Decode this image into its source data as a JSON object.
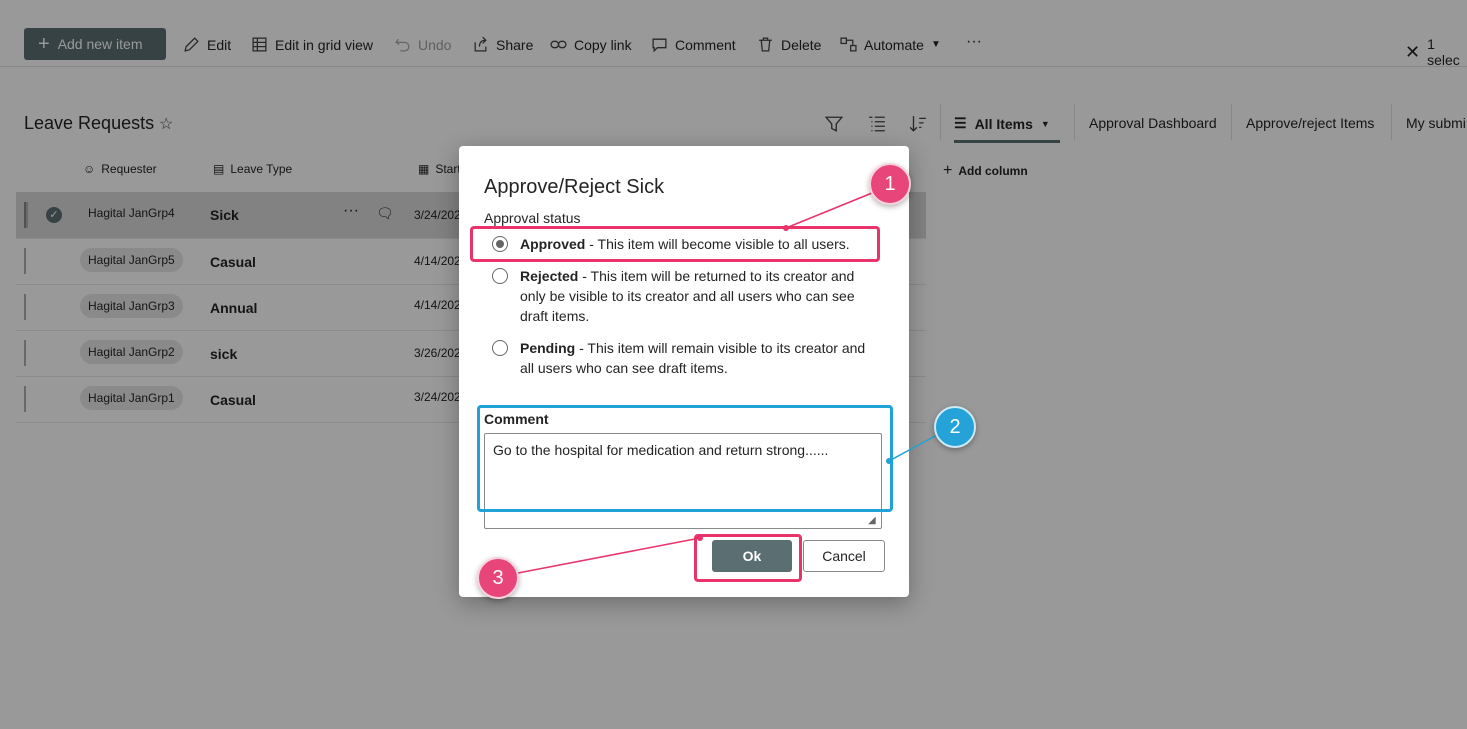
{
  "command_bar": {
    "add_new_item": "Add new item",
    "edit": "Edit",
    "edit_grid": "Edit in grid view",
    "undo": "Undo",
    "share": "Share",
    "copy_link": "Copy link",
    "comment": "Comment",
    "delete": "Delete",
    "automate": "Automate",
    "more": "···",
    "selected": "1 selec"
  },
  "list": {
    "title": "Leave Requests",
    "views": {
      "all_items": "All Items",
      "approval_dashboard": "Approval Dashboard",
      "approve_reject": "Approve/reject Items",
      "my_submi": "My submi"
    },
    "columns": {
      "requester": "Requester",
      "leave_type": "Leave Type",
      "start": "Start",
      "add_column": "Add column"
    },
    "rows": [
      {
        "requester": "Hagital JanGrp4",
        "leave_type": "Sick",
        "start": "3/24/202"
      },
      {
        "requester": "Hagital JanGrp5",
        "leave_type": "Casual",
        "start": "4/14/202"
      },
      {
        "requester": "Hagital JanGrp3",
        "leave_type": "Annual",
        "start": "4/14/202"
      },
      {
        "requester": "Hagital JanGrp2",
        "leave_type": "sick",
        "start": "3/26/202"
      },
      {
        "requester": "Hagital JanGrp1",
        "leave_type": "Casual",
        "start": "3/24/202"
      }
    ],
    "row_more": "···"
  },
  "dialog": {
    "title": "Approve/Reject Sick",
    "approval_status_label": "Approval status",
    "options": [
      {
        "name": "Approved",
        "desc": " - This item will become visible to all users.",
        "selected": true
      },
      {
        "name": "Rejected",
        "desc": " - This item will be returned to its creator and only be visible to its creator and all users who can see draft items.",
        "selected": false
      },
      {
        "name": "Pending",
        "desc": " - This item will remain visible to its creator and all users who can see draft items.",
        "selected": false
      }
    ],
    "comment_label": "Comment",
    "comment_value": "Go to the hospital for medication and return strong......",
    "ok": "Ok",
    "cancel": "Cancel"
  },
  "annotations": {
    "badge1": "1",
    "badge2": "2",
    "badge3": "3",
    "pink": "#e8336b",
    "blue": "#1fa2d6"
  }
}
